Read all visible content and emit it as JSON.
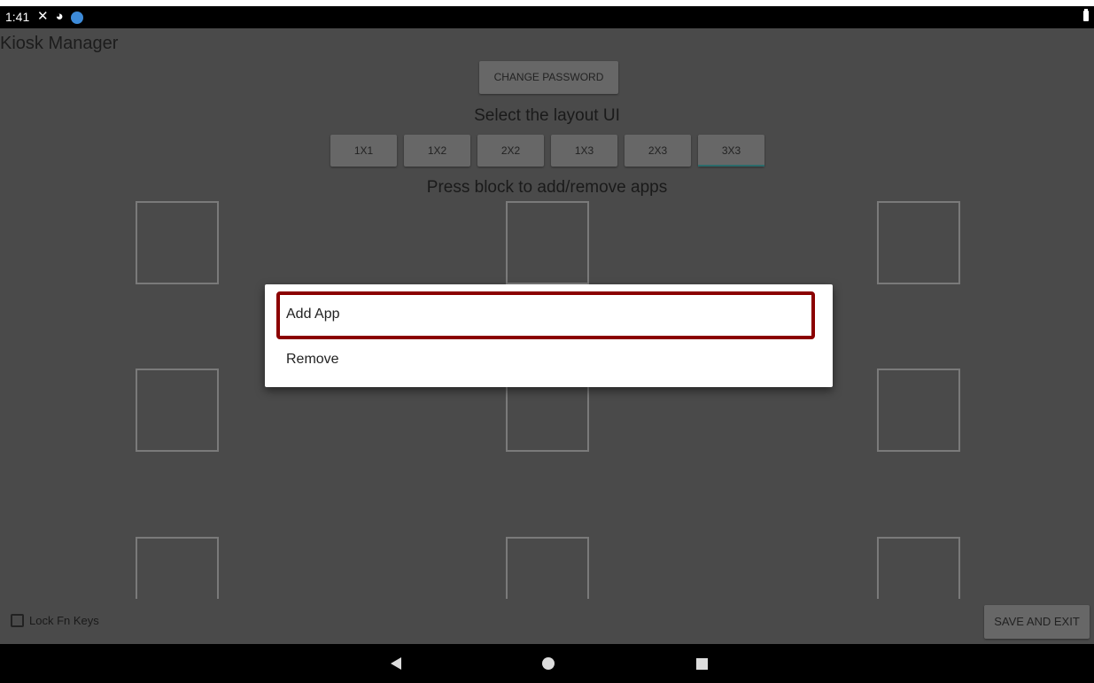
{
  "status_bar": {
    "time": "1:41"
  },
  "app": {
    "title": "Kiosk Manager"
  },
  "buttons": {
    "change_password": "CHANGE PASSWORD",
    "save_and_exit": "SAVE AND EXIT"
  },
  "layout": {
    "label": "Select the layout UI",
    "options": [
      "1X1",
      "1X2",
      "2X2",
      "1X3",
      "2X3",
      "3X3"
    ],
    "selected": "3X3"
  },
  "blocks": {
    "label": "Press block to add/remove apps"
  },
  "lock_fn_keys": {
    "label": "Lock Fn Keys",
    "checked": false
  },
  "dialog": {
    "items": [
      "Add App",
      "Remove"
    ]
  },
  "colors": {
    "highlight": "#8b0000",
    "background": "#4a4a4a"
  }
}
